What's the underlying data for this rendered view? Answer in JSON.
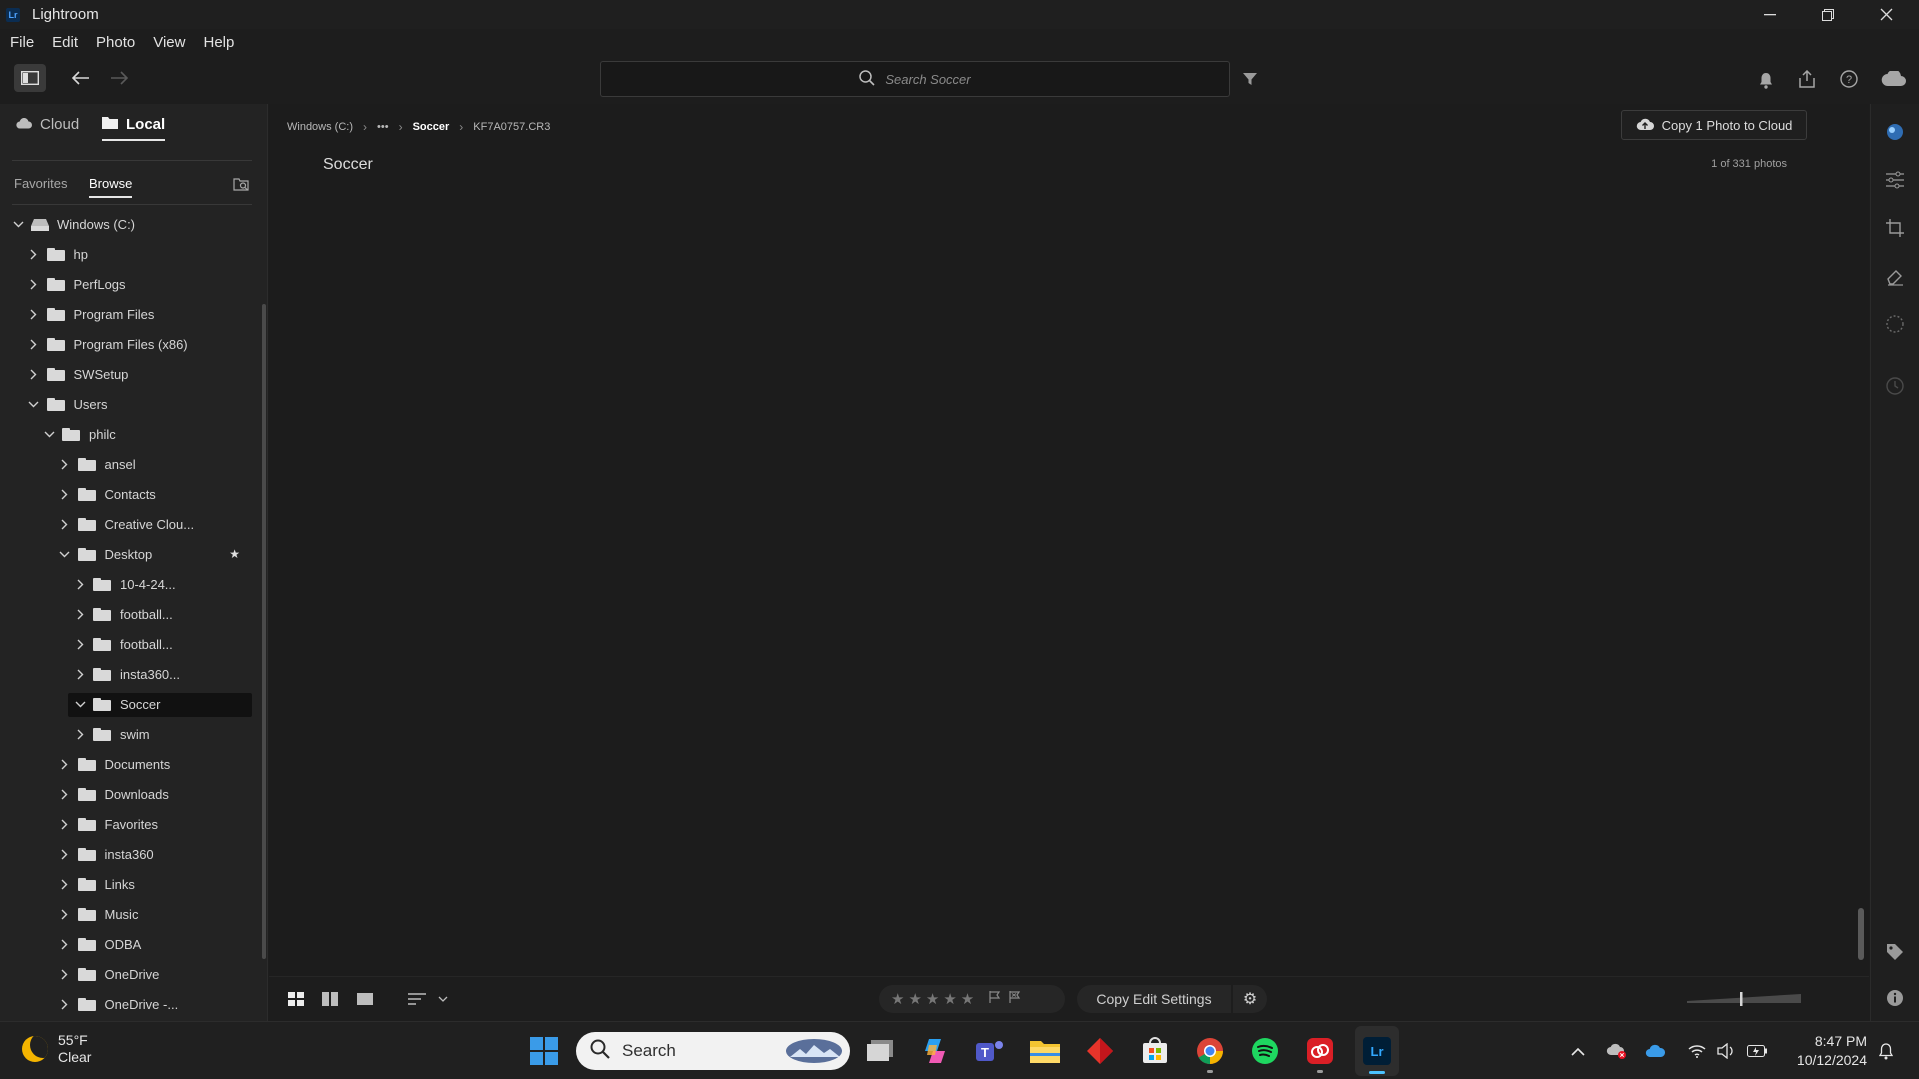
{
  "window": {
    "app_icon": "Lr",
    "title": "Lightroom"
  },
  "menu": [
    "File",
    "Edit",
    "Photo",
    "View",
    "Help"
  ],
  "search": {
    "placeholder": "Search Soccer"
  },
  "source_tabs": {
    "cloud": "Cloud",
    "local": "Local"
  },
  "sub_tabs": {
    "favorites": "Favorites",
    "browse": "Browse"
  },
  "tree": [
    {
      "label": "Windows (C:)",
      "level": 0,
      "expanded": true,
      "type": "drive"
    },
    {
      "label": "hp",
      "level": 1,
      "expanded": false
    },
    {
      "label": "PerfLogs",
      "level": 1,
      "expanded": false
    },
    {
      "label": "Program Files",
      "level": 1,
      "expanded": false
    },
    {
      "label": "Program Files (x86)",
      "level": 1,
      "expanded": false
    },
    {
      "label": "SWSetup",
      "level": 1,
      "expanded": false
    },
    {
      "label": "Users",
      "level": 1,
      "expanded": true
    },
    {
      "label": "philc",
      "level": 2,
      "expanded": true
    },
    {
      "label": "ansel",
      "level": 3,
      "expanded": false
    },
    {
      "label": "Contacts",
      "level": 3,
      "expanded": false
    },
    {
      "label": "Creative Clou...",
      "level": 3,
      "expanded": false
    },
    {
      "label": "Desktop",
      "level": 3,
      "expanded": true,
      "starred": true
    },
    {
      "label": "10-4-24...",
      "level": 4,
      "expanded": false
    },
    {
      "label": "football...",
      "level": 4,
      "expanded": false
    },
    {
      "label": "football...",
      "level": 4,
      "expanded": false
    },
    {
      "label": "insta360...",
      "level": 4,
      "expanded": false
    },
    {
      "label": "Soccer",
      "level": 4,
      "expanded": true,
      "selected": true
    },
    {
      "label": "swim",
      "level": 4,
      "expanded": false
    },
    {
      "label": "Documents",
      "level": 3,
      "expanded": false
    },
    {
      "label": "Downloads",
      "level": 3,
      "expanded": false
    },
    {
      "label": "Favorites",
      "level": 3,
      "expanded": false
    },
    {
      "label": "insta360",
      "level": 3,
      "expanded": false
    },
    {
      "label": "Links",
      "level": 3,
      "expanded": false
    },
    {
      "label": "Music",
      "level": 3,
      "expanded": false
    },
    {
      "label": "ODBA",
      "level": 3,
      "expanded": false
    },
    {
      "label": "OneDrive",
      "level": 3,
      "expanded": false
    },
    {
      "label": "OneDrive -...",
      "level": 3,
      "expanded": false
    }
  ],
  "breadcrumb": {
    "drive": "Windows (C:)",
    "ellipsis": "•••",
    "folder": "Soccer",
    "file": "KF7A0757.CR3"
  },
  "main": {
    "folder_title": "Soccer",
    "copy_button": "Copy 1 Photo to Cloud",
    "count": "1 of 331 photos"
  },
  "bottom": {
    "copy_edit": "Copy Edit Settings",
    "stars": "★★★★★"
  },
  "taskbar": {
    "weather_temp": "55°F",
    "weather_cond": "Clear",
    "search_label": "Search",
    "time": "8:47 PM",
    "date": "10/12/2024"
  },
  "colors": {
    "accent": "#0f6cbd",
    "lightroom_blue": "#31a8ff",
    "background": "#1c1c1c"
  }
}
